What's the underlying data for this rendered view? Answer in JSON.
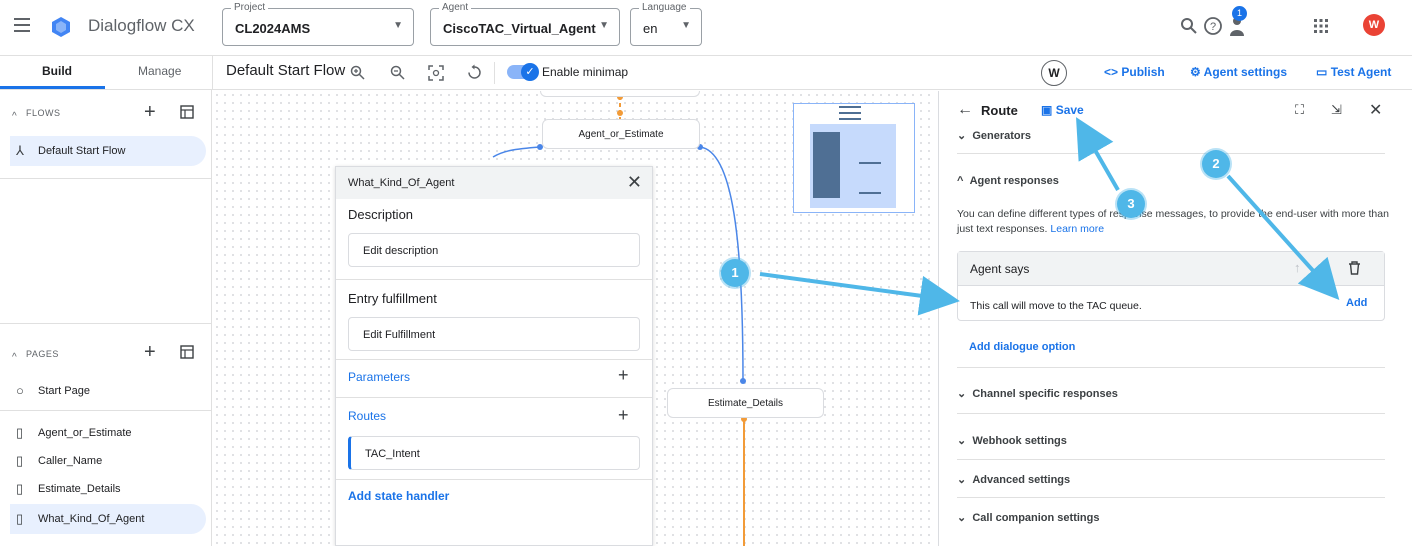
{
  "app": {
    "title": "Dialogflow CX"
  },
  "selectors": {
    "project": {
      "label": "Project",
      "value": "CL2024AMS"
    },
    "agent": {
      "label": "Agent",
      "value": "CiscoTAC_Virtual_Agent"
    },
    "language": {
      "label": "Language",
      "value": "en"
    }
  },
  "topbar": {
    "notification_count": "1",
    "avatar_initial": "W"
  },
  "tabs": {
    "build": "Build",
    "manage": "Manage"
  },
  "toolbar": {
    "flow_title": "Default Start Flow",
    "minimap_label": "Enable minimap",
    "user_initial": "W",
    "publish": "Publish",
    "agent_settings": "Agent settings",
    "test_agent": "Test Agent"
  },
  "sidebar": {
    "flows_heading": "FLOWS",
    "flows": [
      {
        "label": "Default Start Flow"
      }
    ],
    "pages_heading": "PAGES",
    "pages": [
      {
        "label": "Start Page"
      },
      {
        "label": "Agent_or_Estimate"
      },
      {
        "label": "Caller_Name"
      },
      {
        "label": "Estimate_Details"
      },
      {
        "label": "What_Kind_Of_Agent"
      }
    ]
  },
  "canvas": {
    "nodes": {
      "agent_or_estimate": "Agent_or_Estimate",
      "estimate_details": "Estimate_Details"
    }
  },
  "page_panel": {
    "title": "What_Kind_Of_Agent",
    "description_label": "Description",
    "description_placeholder": "Edit description",
    "entry_label": "Entry fulfillment",
    "entry_placeholder": "Edit Fulfillment",
    "parameters": "Parameters",
    "routes": "Routes",
    "route_item": "TAC_Intent",
    "add_state_handler": "Add state handler"
  },
  "route_panel": {
    "title": "Route",
    "save": "Save",
    "generators": "Generators",
    "agent_responses": "Agent responses",
    "description": "You can define different types of response messages, to provide the end-user with more than just text responses.",
    "learn_more": "Learn more",
    "agent_says": "Agent says",
    "message": "This call will move to the TAC queue.",
    "add": "Add",
    "add_dialogue_option": "Add dialogue option",
    "channel_specific": "Channel specific responses",
    "webhook_settings": "Webhook settings",
    "advanced_settings": "Advanced settings",
    "call_companion": "Call companion settings"
  },
  "annotations": {
    "one": "1",
    "two": "2",
    "three": "3"
  },
  "colors": {
    "accent": "#1a73e8",
    "callout": "#4fb7e8",
    "flow_line_orange": "#f29b38"
  }
}
